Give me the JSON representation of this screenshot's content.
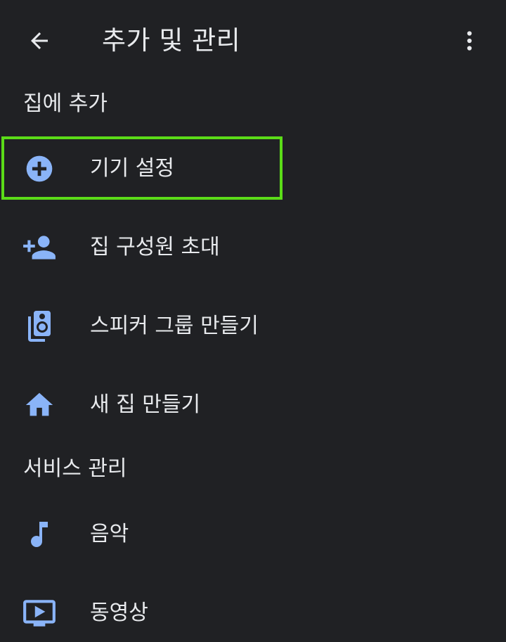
{
  "header": {
    "title": "추가 및 관리",
    "back_icon": "arrow-back-icon",
    "more_icon": "more-vert-icon"
  },
  "sections": {
    "add_to_home": {
      "title": "집에 추가",
      "items": [
        {
          "label": "기기 설정",
          "icon": "add-circle-icon"
        },
        {
          "label": "집 구성원 초대",
          "icon": "person-add-icon"
        },
        {
          "label": "스피커 그룹 만들기",
          "icon": "speaker-group-icon"
        },
        {
          "label": "새 집 만들기",
          "icon": "home-icon"
        }
      ]
    },
    "manage_services": {
      "title": "서비스 관리",
      "items": [
        {
          "label": "음악",
          "icon": "music-note-icon"
        },
        {
          "label": "동영상",
          "icon": "video-play-icon"
        }
      ]
    }
  },
  "colors": {
    "background": "#202124",
    "text": "#e8eaed",
    "icon_accent": "#8ab4f8",
    "highlight": "#5bdc18"
  }
}
